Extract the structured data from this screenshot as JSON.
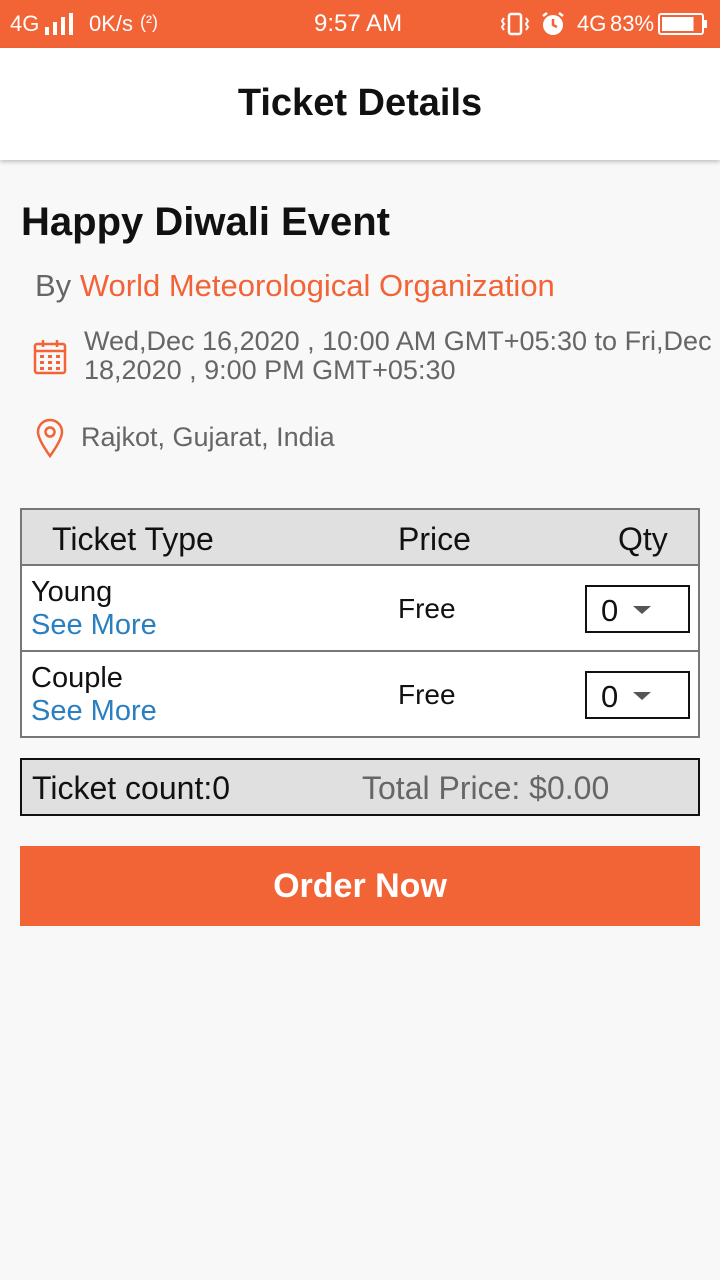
{
  "status_bar": {
    "network_left": "4G",
    "speed": "0K/s",
    "hotspot": "(²)",
    "time": "9:57 AM",
    "network_right": "4G",
    "battery_percent": "83%",
    "battery_level": 0.83,
    "icons": [
      "signal-icon",
      "hotspot-icon",
      "vibrate-icon",
      "alarm-icon",
      "battery-icon"
    ]
  },
  "app_bar": {
    "title": "Ticket Details"
  },
  "event": {
    "title": "Happy Diwali Event",
    "by_label": "By",
    "organizer": "World Meteorological Organization",
    "date_range": "Wed,Dec 16,2020 , 10:00 AM GMT+05:30 to Fri,Dec 18,2020 , 9:00 PM GMT+05:30",
    "location": "Rajkot, Gujarat, India",
    "icons": {
      "date": "calendar-icon",
      "location": "location-pin-icon"
    }
  },
  "ticket_table": {
    "headers": {
      "type": "Ticket Type",
      "price": "Price",
      "qty": "Qty"
    },
    "rows": [
      {
        "name": "Young",
        "more": "See More",
        "price": "Free",
        "qty": "0"
      },
      {
        "name": "Couple",
        "more": "See More",
        "price": "Free",
        "qty": "0"
      }
    ]
  },
  "summary": {
    "ticket_count": "Ticket count:0",
    "total_price": "Total Price: $0.00"
  },
  "order_button": {
    "label": "Order Now"
  },
  "colors": {
    "accent": "#f26336",
    "link": "#2a7fc1",
    "header_bg": "#e0e0e0",
    "page_bg": "#f8f8f8"
  }
}
